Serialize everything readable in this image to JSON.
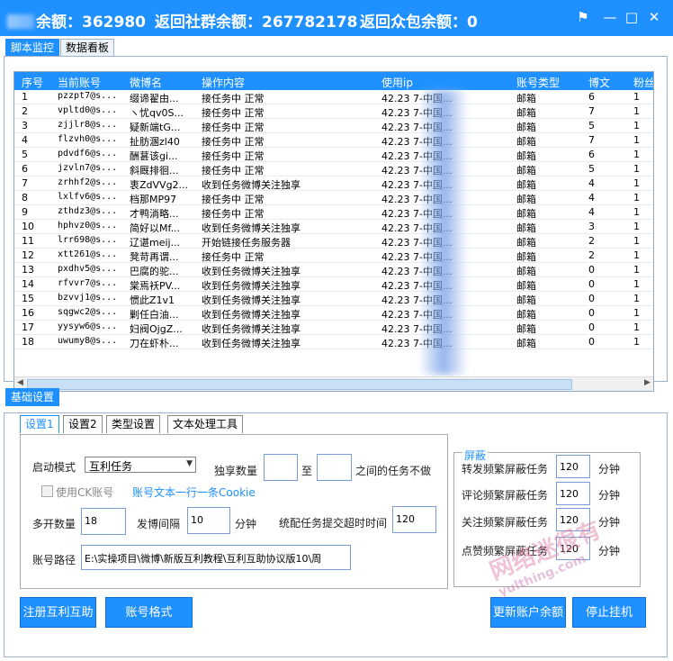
{
  "titlebar": {
    "balance_label": "余额：",
    "balance_value": "362980",
    "community_label": "返回社群余额：",
    "community_value": "267782178",
    "crowd_label": "返回众包余额：",
    "crowd_value": "0"
  },
  "main_tabs": [
    {
      "label": "脚本监控",
      "active": true
    },
    {
      "label": "数据看板",
      "active": false
    }
  ],
  "table": {
    "columns": [
      "序号",
      "当前账号",
      "微博名",
      "操作内容",
      "使用ip",
      "账号类型",
      "博文",
      "粉丝"
    ],
    "rows": [
      {
        "no": "1",
        "account": "pzzpt7@s...",
        "name": "缀谛翟由...",
        "action": "接任务中  正常",
        "ip": "42.23    7-中国...",
        "type": "邮箱",
        "posts": "6",
        "fans": "1"
      },
      {
        "no": "2",
        "account": "vpltd0@s...",
        "name": "ヽ忧qv0S...",
        "action": "接任务中  正常",
        "ip": "42.23    7-中国...",
        "type": "邮箱",
        "posts": "7",
        "fans": "1"
      },
      {
        "no": "3",
        "account": "zjjlr8@s...",
        "name": "疑新端tG...",
        "action": "接任务中  正常",
        "ip": "42.23    7-中国...",
        "type": "邮箱",
        "posts": "5",
        "fans": "1"
      },
      {
        "no": "4",
        "account": "flzvh0@s...",
        "name": "扯肪溷zl40",
        "action": "接任务中  正常",
        "ip": "42.23    7-中国...",
        "type": "邮箱",
        "posts": "7",
        "fans": "1"
      },
      {
        "no": "5",
        "account": "pdvdf6@s...",
        "name": "酬葚该gi...",
        "action": "接任务中  正常",
        "ip": "42.23    7-中国...",
        "type": "邮箱",
        "posts": "6",
        "fans": "1"
      },
      {
        "no": "6",
        "account": "jzvln7@s...",
        "name": "斜厩排徊...",
        "action": "接任务中  正常",
        "ip": "42.23    7-中国...",
        "type": "邮箱",
        "posts": "5",
        "fans": "1"
      },
      {
        "no": "7",
        "account": "zrhhf2@s...",
        "name": "衷ZdVVg2...",
        "action": "收到任务微博关注独享",
        "ip": "42.23    7-中国...",
        "type": "邮箱",
        "posts": "4",
        "fans": "1"
      },
      {
        "no": "8",
        "account": "lxlfv6@s...",
        "name": "档那MP97",
        "action": "接任务中  正常",
        "ip": "42.23    7-中国...",
        "type": "邮箱",
        "posts": "4",
        "fans": "1"
      },
      {
        "no": "9",
        "account": "zthdz3@s...",
        "name": "才鸭淌略...",
        "action": "接任务中  正常",
        "ip": "42.23    7-中国...",
        "type": "邮箱",
        "posts": "4",
        "fans": "1"
      },
      {
        "no": "10",
        "account": "hphvz0@s...",
        "name": "简好以Mf...",
        "action": "收到任务微博关注独享",
        "ip": "42.23    7-中国...",
        "type": "邮箱",
        "posts": "3",
        "fans": "1"
      },
      {
        "no": "11",
        "account": "lrr698@s...",
        "name": "辽谌meij...",
        "action": "开始链接任务服务器",
        "ip": "42.23    7-中国...",
        "type": "邮箱",
        "posts": "2",
        "fans": "1"
      },
      {
        "no": "12",
        "account": "xtt261@s...",
        "name": "凳苛再谓...",
        "action": "接任务中  正常",
        "ip": "42.23    7-中国...",
        "type": "邮箱",
        "posts": "2",
        "fans": "1"
      },
      {
        "no": "13",
        "account": "pxdhv5@s...",
        "name": "巴腐的驼...",
        "action": "收到任务微博关注独享",
        "ip": "42.23    7-中国...",
        "type": "邮箱",
        "posts": "0",
        "fans": "1"
      },
      {
        "no": "14",
        "account": "rfvvr7@s...",
        "name": "棠焉袄PV...",
        "action": "收到任务微博关注独享",
        "ip": "42.23    7-中国...",
        "type": "邮箱",
        "posts": "0",
        "fans": "1"
      },
      {
        "no": "15",
        "account": "bzvvj1@s...",
        "name": "惯此Z1v1",
        "action": "收到任务微博关注独享",
        "ip": "42.23    7-中国...",
        "type": "邮箱",
        "posts": "0",
        "fans": "1"
      },
      {
        "no": "16",
        "account": "sqgwc2@s...",
        "name": "剿任白油...",
        "action": "收到任务微博关注独享",
        "ip": "42.23    7-中国...",
        "type": "邮箱",
        "posts": "0",
        "fans": "1"
      },
      {
        "no": "17",
        "account": "yysyw6@s...",
        "name": "妇阀OjgZ...",
        "action": "收到任务微博关注独享",
        "ip": "42.23    7-中国...",
        "type": "邮箱",
        "posts": "0",
        "fans": "1"
      },
      {
        "no": "18",
        "account": "uwumy8@s...",
        "name": "刀在虾朴...",
        "action": "收到任务微博关注独享",
        "ip": "42.23    7-中国...",
        "type": "邮箱",
        "posts": "0",
        "fans": "1"
      }
    ]
  },
  "basic_tab": "基础设置",
  "settings_tabs": [
    "设置1",
    "设置2",
    "类型设置",
    "文本处理工具"
  ],
  "form": {
    "start_mode_label": "启动模式",
    "start_mode_value": "互利任务",
    "exclusive_label": "独享数量",
    "exclusive_from": "",
    "to_label": "至",
    "exclusive_to": "",
    "range_suffix": "之间的任务不做",
    "ck_label": "使用CK账号",
    "ck_hint": "账号文本一行一条Cookie",
    "multi_label": "多开数量",
    "multi_value": "18",
    "interval_label": "发博间隔",
    "interval_value": "10",
    "minute": "分钟",
    "timeout_label": "统配任务提交超时时间",
    "timeout_value": "120",
    "path_label": "账号路径",
    "path_value": "E:\\实操项目\\微博\\新版互利教程\\互利互助协议版10\\周"
  },
  "shield": {
    "title": "屏蔽",
    "items": [
      {
        "label": "转发频繁屏蔽任务",
        "value": "120",
        "unit": "分钟"
      },
      {
        "label": "评论频繁屏蔽任务",
        "value": "120",
        "unit": "分钟"
      },
      {
        "label": "关注频繁屏蔽任务",
        "value": "120",
        "unit": "分钟"
      },
      {
        "label": "点赞频繁屏蔽任务",
        "value": "120",
        "unit": "分钟"
      }
    ]
  },
  "buttons": {
    "register": "注册互利互助",
    "account_format": "账号格式",
    "update_balance": "更新账户余额",
    "stop": "停止挂机"
  },
  "watermark": {
    "main": "网络迷很有",
    "sub": "yulthing.com"
  }
}
